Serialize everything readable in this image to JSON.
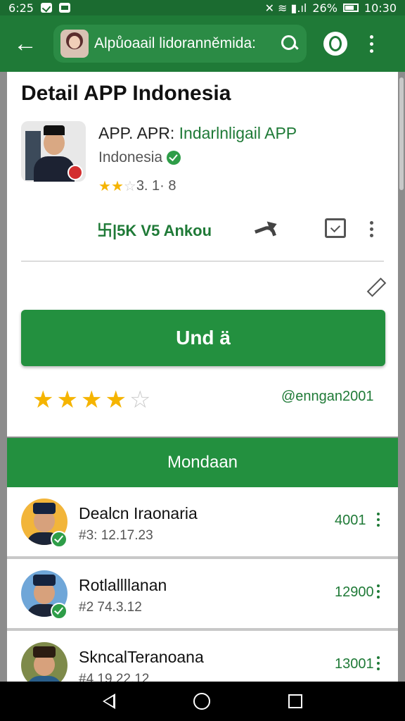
{
  "status_bar": {
    "time": "6:25",
    "battery": "26%",
    "clock": "10:30"
  },
  "header": {
    "search_text": "Alpůoaail lidoranněmida:"
  },
  "app": {
    "page_title": "Detail APP Indonesia",
    "name_prefix": "APP. APR:",
    "name_highlight": "Indarlnligail APP",
    "publisher": "Indonesia",
    "rating_value": "3. 1· 8",
    "stars_filled": 2,
    "install_label": "卐|5K  V5 Ankou",
    "update_label": "Und ä",
    "user_stars": 4,
    "user_handle": "@enngan2001"
  },
  "section": {
    "title": "Mondaan"
  },
  "items": [
    {
      "name": "Dealcn Iraonaria",
      "date": "#3: 12.17.23",
      "count": "4001"
    },
    {
      "name": "Rotlallllanan",
      "date": "#2 74.3.12",
      "count": "12900"
    },
    {
      "name": "SkncalTeranoana",
      "date": "#4 19.22.12",
      "count": "13001"
    }
  ],
  "colors": {
    "primary": "#1f7a37",
    "button": "#23903f",
    "star": "#f5b400"
  },
  "icons": [
    "back-arrow-icon",
    "search-icon",
    "account-icon",
    "more-vert-icon",
    "verified-icon",
    "star-icon",
    "share-icon",
    "bookmark-icon",
    "edit-icon"
  ]
}
